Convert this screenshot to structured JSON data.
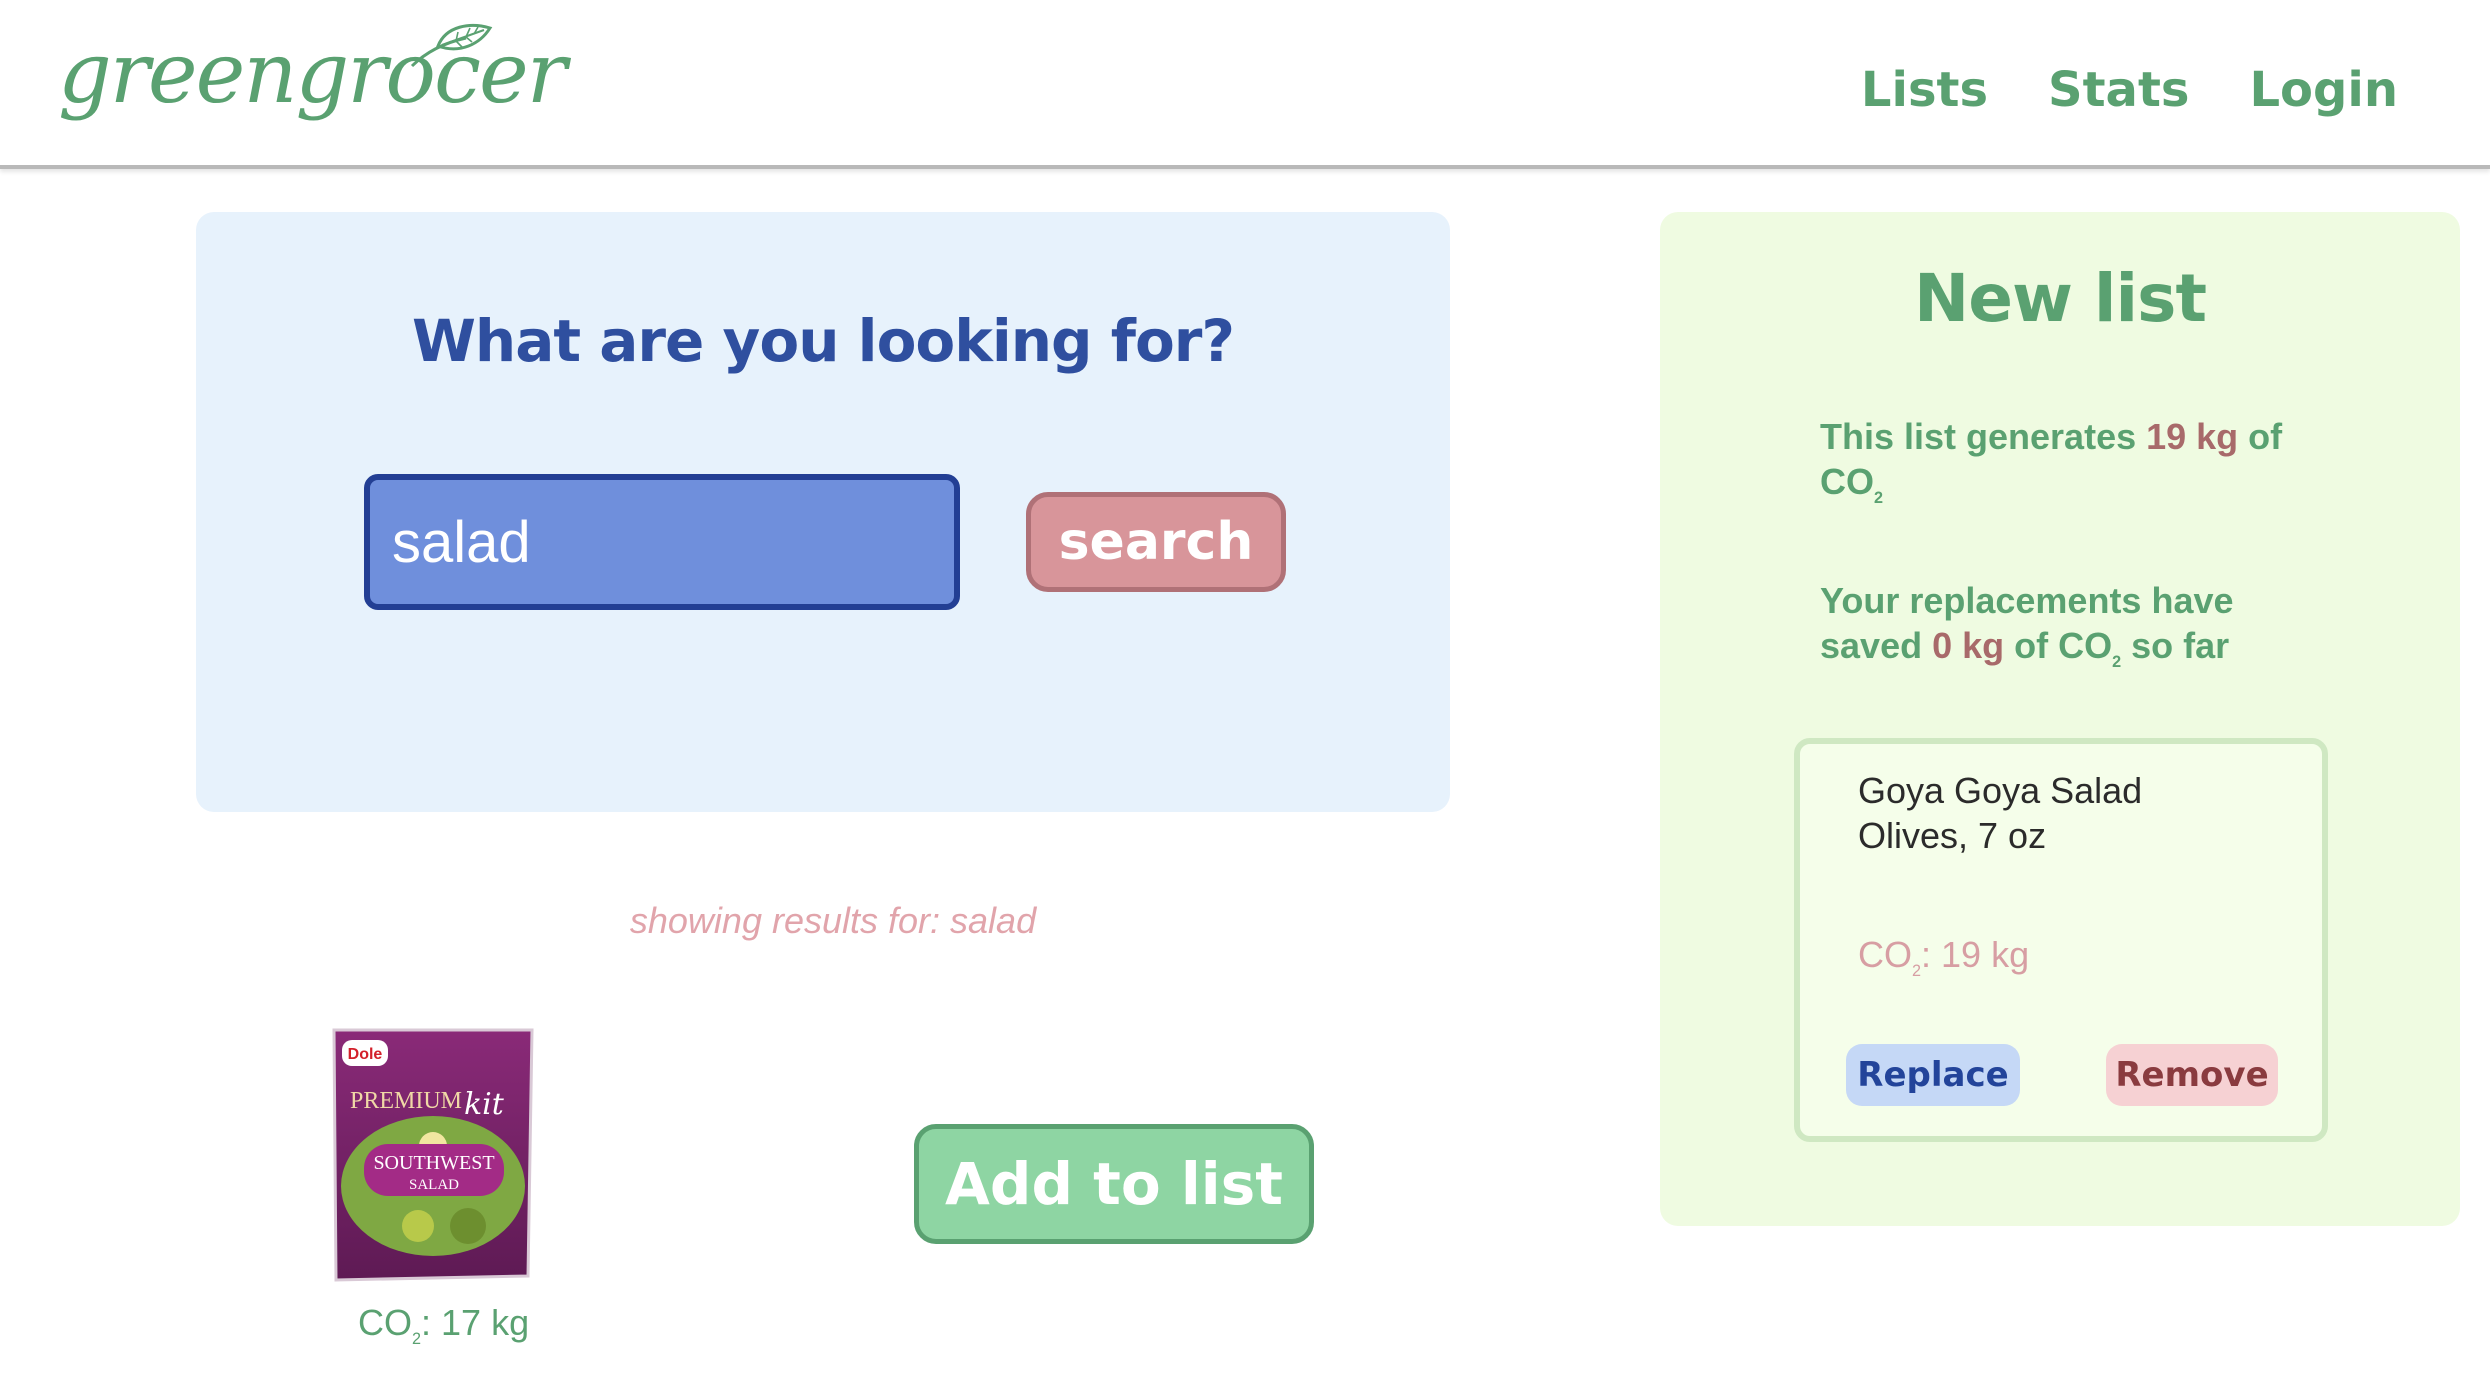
{
  "header": {
    "logo_text": "greengrocer",
    "nav": {
      "lists": "Lists",
      "stats": "Stats",
      "login": "Login"
    }
  },
  "search": {
    "title": "What are you looking for?",
    "input_value": "salad",
    "button_label": "search",
    "results_label": "showing results for: salad"
  },
  "product": {
    "image_brand": "Dole",
    "image_line1": "PREMIUM",
    "image_line2": "kit",
    "image_line3": "SOUTHWEST",
    "image_line4": "SALAD",
    "co2_label": "CO",
    "co2_sub": "2",
    "co2_value": ": 17 kg",
    "add_button_label": "Add to list"
  },
  "list": {
    "title": "New list",
    "stat1_prefix": "This list generates ",
    "stat1_value": "19 kg",
    "stat1_suffix": " of",
    "stat1_unit": "CO",
    "stat1_unit_sub": "2",
    "stat2_prefix": "Your replacements have saved ",
    "stat2_value": "0 kg",
    "stat2_mid": " of CO",
    "stat2_sub": "2",
    "stat2_suffix": " so far",
    "item": {
      "name": "Goya Goya Salad Olives, 7 oz",
      "co2_label": "CO",
      "co2_sub": "2",
      "co2_value": ": 19 kg",
      "replace_label": "Replace",
      "remove_label": "Remove"
    }
  },
  "colors": {
    "brand_green": "#5aa171",
    "search_blue": "#2f4f9f",
    "search_panel_bg": "#e7f2fc",
    "list_panel_bg": "#effbe1",
    "highlight_red": "#a86a6a",
    "pink_text": "#e1a4ab"
  }
}
